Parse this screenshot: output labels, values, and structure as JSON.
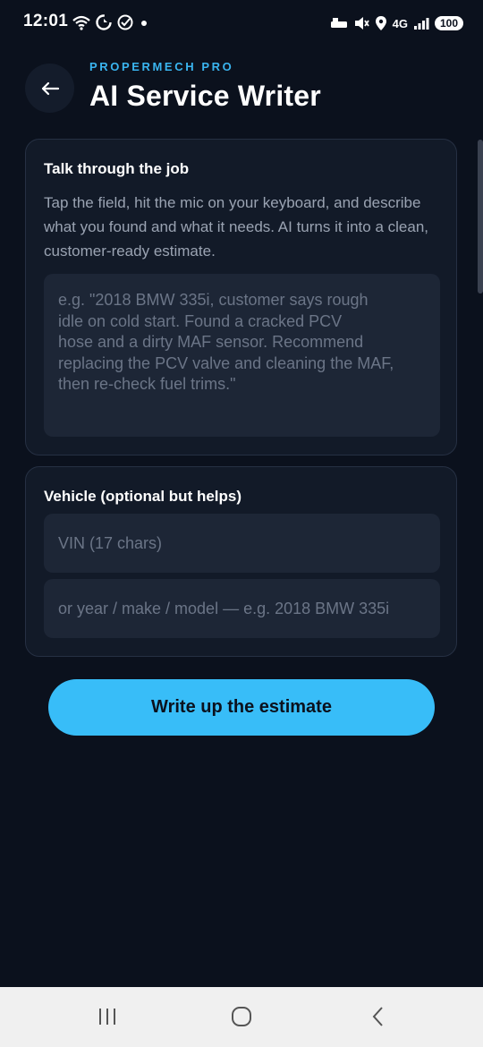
{
  "status_bar": {
    "time": "12:01",
    "network": "4G",
    "battery": "100",
    "icons": [
      "wifi-calling-icon",
      "sync-icon",
      "check-circle-icon",
      "dot-icon",
      "bluetooth-icon",
      "mute-icon",
      "location-icon",
      "signal-icon"
    ]
  },
  "header": {
    "brand": "PROPERMECH PRO",
    "title": "AI Service Writer",
    "back_icon": "arrow-left-icon"
  },
  "job_card": {
    "title": "Talk through the job",
    "description": "Tap the field, hit the mic on your keyboard, and describe what you found and what it needs. AI turns it into a clean, customer-ready estimate.",
    "placeholder": "e.g. \"2018 BMW 335i, customer says rough\nidle on cold start. Found a cracked PCV\nhose and a dirty MAF sensor. Recommend\nreplacing the PCV valve and cleaning the MAF,\nthen re-check fuel trims.\""
  },
  "vehicle_card": {
    "title": "Vehicle (optional but helps)",
    "vin_placeholder": "VIN (17 chars)",
    "ymm_placeholder": "or year / make / model — e.g. 2018 BMW 335i"
  },
  "cta": {
    "label": "Write up the estimate"
  },
  "colors": {
    "background": "#0b111d",
    "accent": "#3ab5f0",
    "button": "#38bdf8",
    "card": "#121a28"
  },
  "nav_bar": {
    "icons": [
      "recent-apps-icon",
      "home-icon",
      "back-icon"
    ]
  }
}
